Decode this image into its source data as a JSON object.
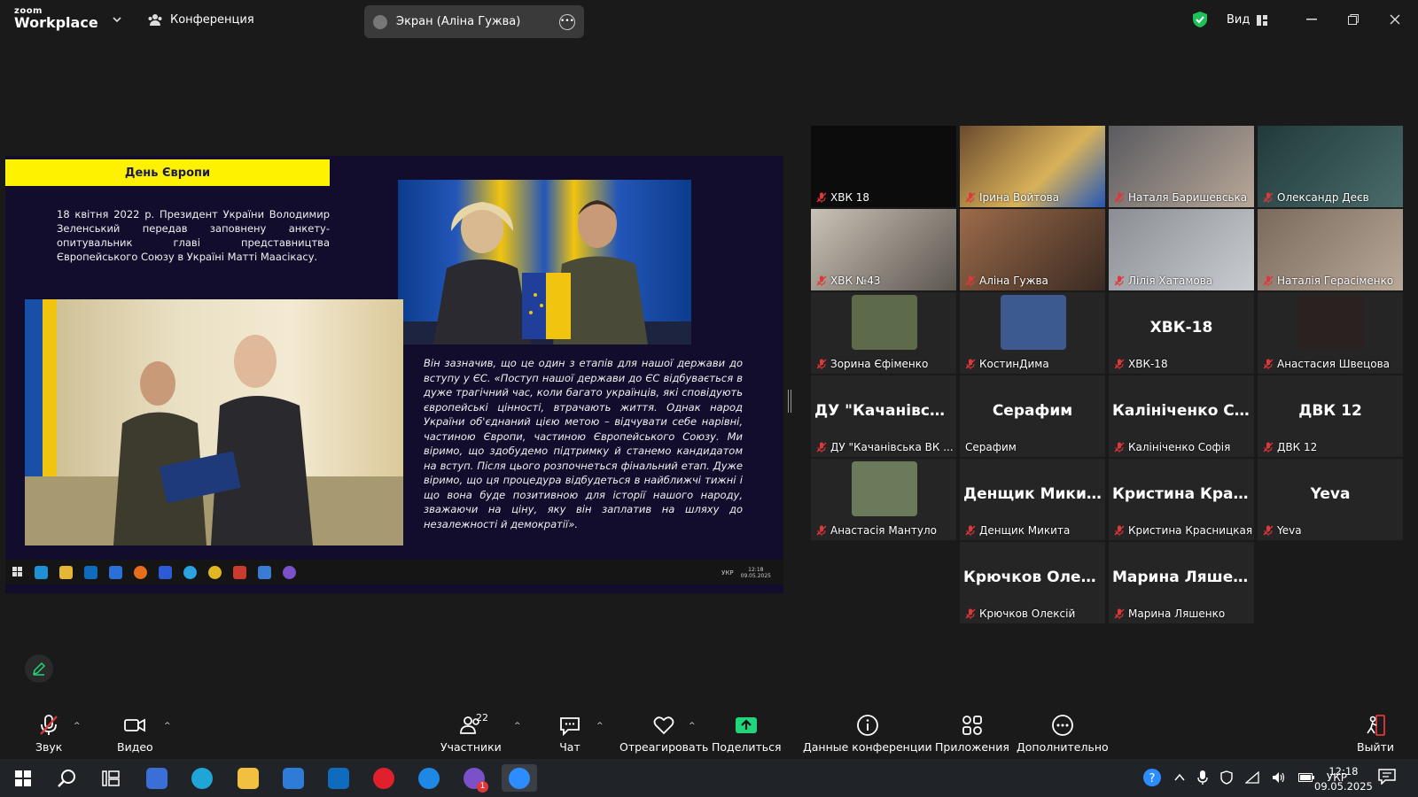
{
  "titlebar": {
    "logo_top": "zoom",
    "logo_bottom": "Workplace",
    "meeting_label": "Конференция",
    "share_label": "Экран (Аліна Гужва)",
    "view_label": "Вид"
  },
  "slide": {
    "title": "День Європи",
    "paragraph1": "18 квітня 2022 р. Президент України Володимир Зеленський передав заповнену анкету-опитувальник главі представництва Європейського Союзу в Україні Матті Маасікасу.",
    "paragraph2": "Він зазначив, що це один з етапів для нашої держави до вступу у ЄС. «Поступ нашої держави до ЄС відбувається в дуже трагічний час, коли багато українців, які сповідують європейські цінності, втрачають життя. Однак народ України об'єднаний цією метою – відчувати себе нарівні, частиною Європи, частиною Європейського Союзу. Ми віримо, що здобудемо підтримку й станемо кандидатом на вступ. Після цього розпочнеться фінальний етап. Дуже віримо, що ця процедура відбудеться в найближчі тижні і що вона буде позитивною для історії нашого народу, зважаючи на ціну, яку він заплатив на шляху до незалежності й демократії».",
    "taskbar_lang": "УКР",
    "taskbar_time": "12:18",
    "taskbar_date": "09.05.2025"
  },
  "participants": [
    {
      "name": "ХВК 18",
      "big": "",
      "kind": "dark"
    },
    {
      "name": "Ірина Войтова",
      "big": "",
      "kind": "video"
    },
    {
      "name": "Наталя Баришевська",
      "big": "",
      "kind": "video"
    },
    {
      "name": "Олександр Деєв",
      "big": "",
      "kind": "video"
    },
    {
      "name": "ХВК №43",
      "big": "",
      "kind": "video"
    },
    {
      "name": "Аліна Гужва",
      "big": "",
      "kind": "video"
    },
    {
      "name": "Лілія Хатамова",
      "big": "",
      "kind": "video"
    },
    {
      "name": "Наталія Герасіменко",
      "big": "",
      "kind": "video"
    },
    {
      "name": "Зорина Єфіменко",
      "big": "",
      "kind": "avatar"
    },
    {
      "name": "КостинДима",
      "big": "",
      "kind": "avatar"
    },
    {
      "name": "ХВК-18",
      "big": "ХВК-18",
      "kind": "text"
    },
    {
      "name": "Анастасия Швецова",
      "big": "",
      "kind": "avatar"
    },
    {
      "name": "ДУ \"Качанівська ВК ...",
      "big": "ДУ \"Качанівськ...",
      "kind": "text"
    },
    {
      "name": "Серафим",
      "big": "Серафим",
      "kind": "text"
    },
    {
      "name": "Калініченко Софія",
      "big": "Калініченко Со...",
      "kind": "text"
    },
    {
      "name": "ДВК 12",
      "big": "ДВК 12",
      "kind": "text"
    },
    {
      "name": "Анастасія Мантуло",
      "big": "",
      "kind": "avatar"
    },
    {
      "name": "Денщик Микита",
      "big": "Денщик Микита",
      "kind": "text"
    },
    {
      "name": "Кристина Красницкая",
      "big": "Кристина Крас...",
      "kind": "text"
    },
    {
      "name": "Yeva",
      "big": "Yeva",
      "kind": "text"
    },
    {
      "name": "Крючков Олексій",
      "big": "Крючков Олек...",
      "kind": "text"
    },
    {
      "name": "Марина Ляшенко",
      "big": "Марина Ляшен...",
      "kind": "text"
    }
  ],
  "toolbar": {
    "audio": "Звук",
    "video": "Видео",
    "participants": "Участники",
    "participants_count": "22",
    "chat": "Чат",
    "react": "Отреагировать",
    "share": "Поделиться",
    "info": "Данные конференции",
    "apps": "Приложения",
    "more": "Дополнительно",
    "leave": "Выйти"
  },
  "windows_taskbar": {
    "lang": "УКР",
    "time": "12:18",
    "date": "09.05.2025",
    "viber_badge": "1"
  },
  "colors": {
    "accent_green": "#22d47b",
    "slide_title_bg": "#fff200",
    "mic_muted_red": "#e0373b",
    "toolbar_bg": "#1a1a1a"
  }
}
